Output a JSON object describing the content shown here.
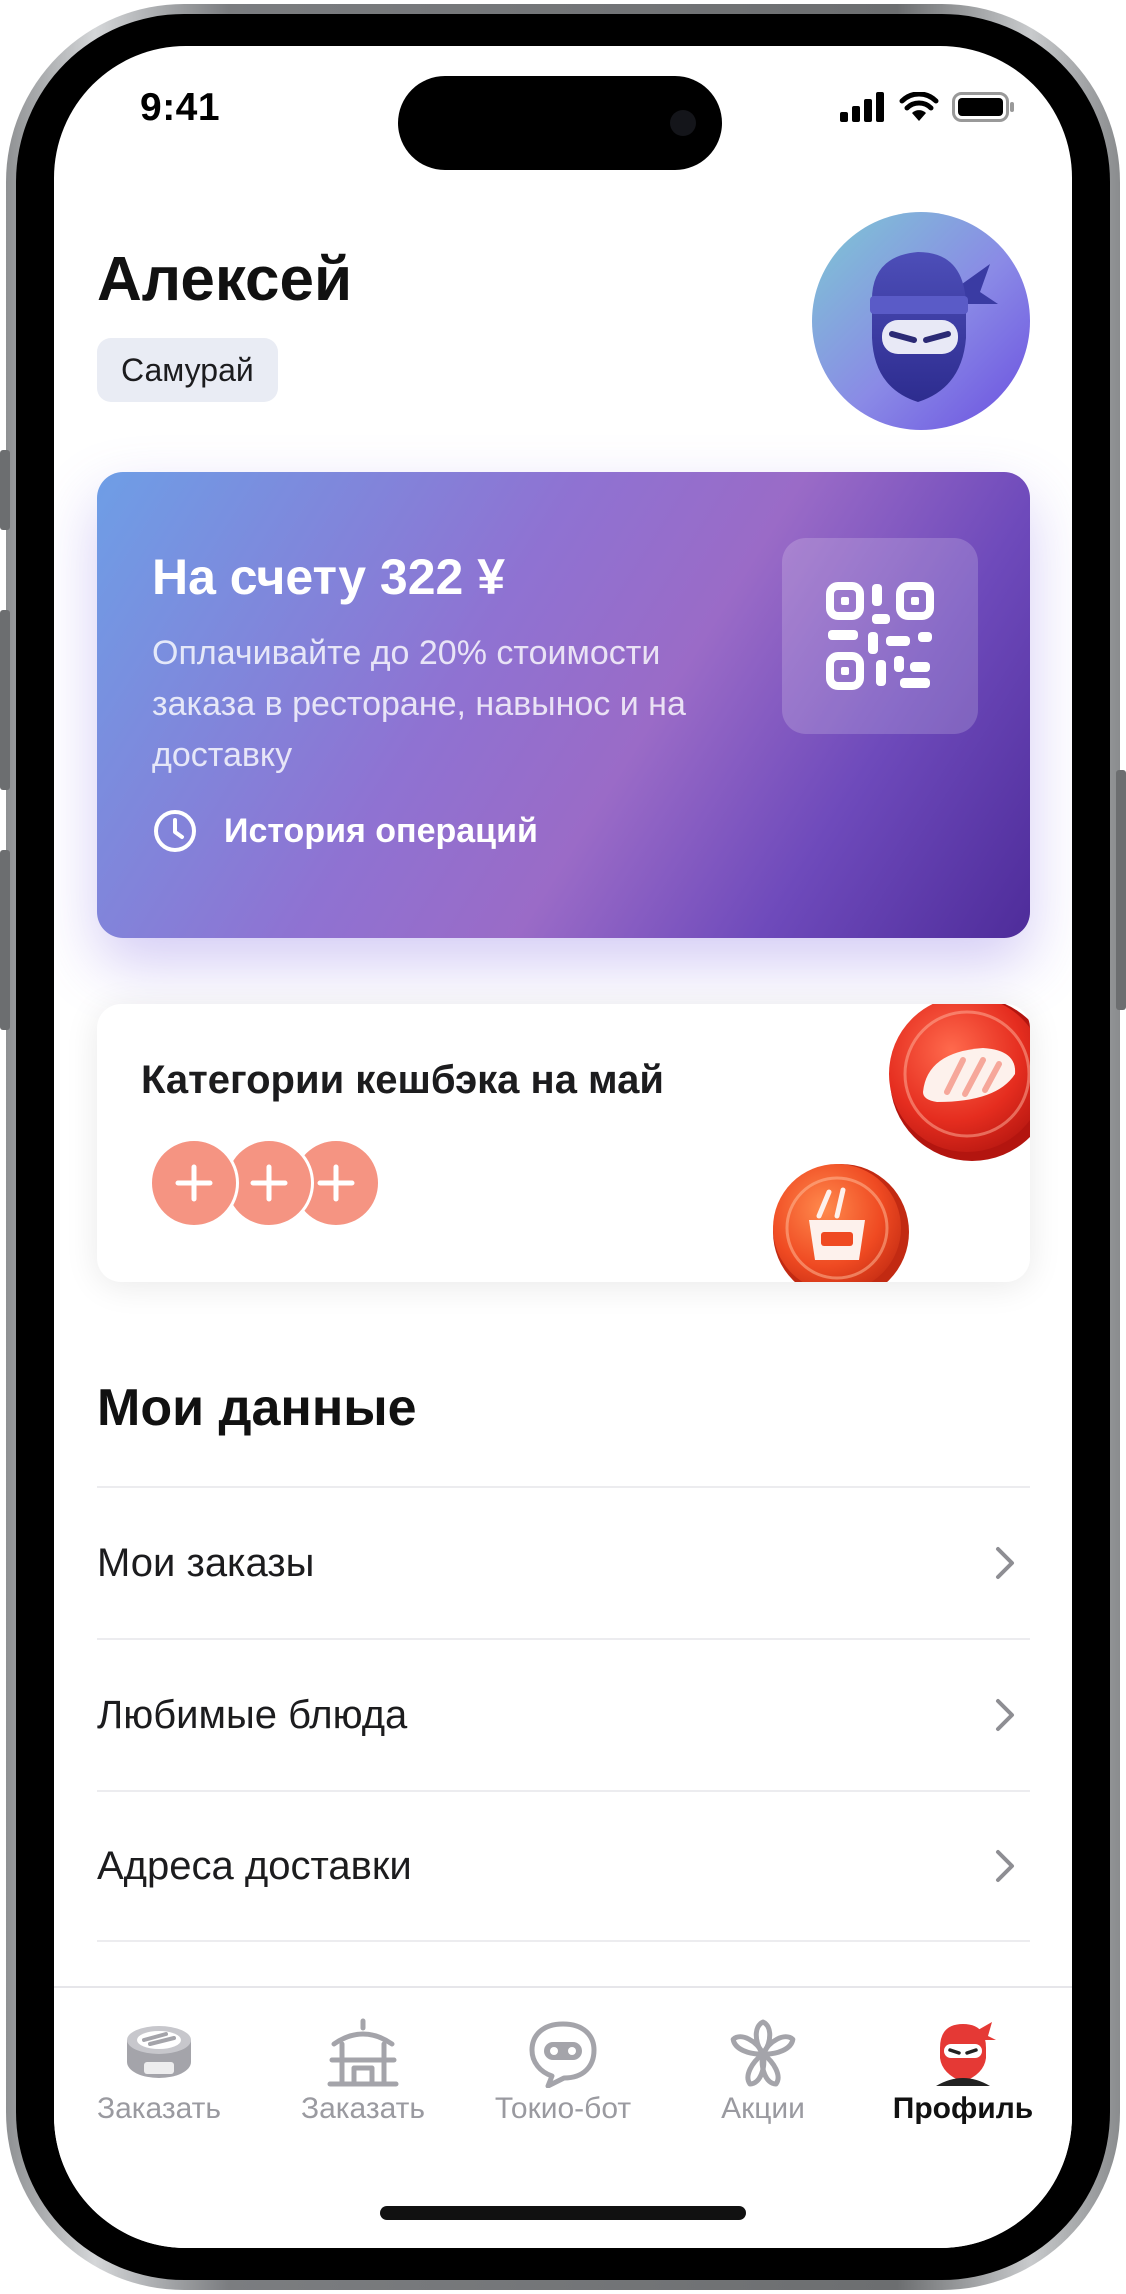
{
  "status_bar": {
    "time": "9:41"
  },
  "header": {
    "user_name": "Алексей",
    "rank": "Самурай"
  },
  "balance_card": {
    "title": "На счету 322 ¥",
    "description": "Оплачивайте до 20% стоимости заказа в ресторане, навынос и на доставку",
    "history_label": "История операций"
  },
  "cashback": {
    "title": "Категории кешбэка на май"
  },
  "my_data": {
    "title": "Мои данные",
    "items": [
      {
        "label": "Мои заказы"
      },
      {
        "label": "Любимые блюда"
      },
      {
        "label": "Адреса доставки"
      }
    ]
  },
  "tab_bar": {
    "tabs": [
      {
        "label": "Заказать",
        "icon": "sushi-roll-icon",
        "active": false
      },
      {
        "label": "Заказать",
        "icon": "pagoda-icon",
        "active": false
      },
      {
        "label": "Токио-бот",
        "icon": "chat-bot-icon",
        "active": false
      },
      {
        "label": "Акции",
        "icon": "sakura-flower-icon",
        "active": false
      },
      {
        "label": "Профиль",
        "icon": "ninja-profile-icon",
        "active": true
      }
    ]
  },
  "colors": {
    "accent": "#e53935",
    "cashback_plus": "#f59482",
    "badge_bg": "#e9ecf4",
    "inactive_tab": "#9a9aa0"
  }
}
